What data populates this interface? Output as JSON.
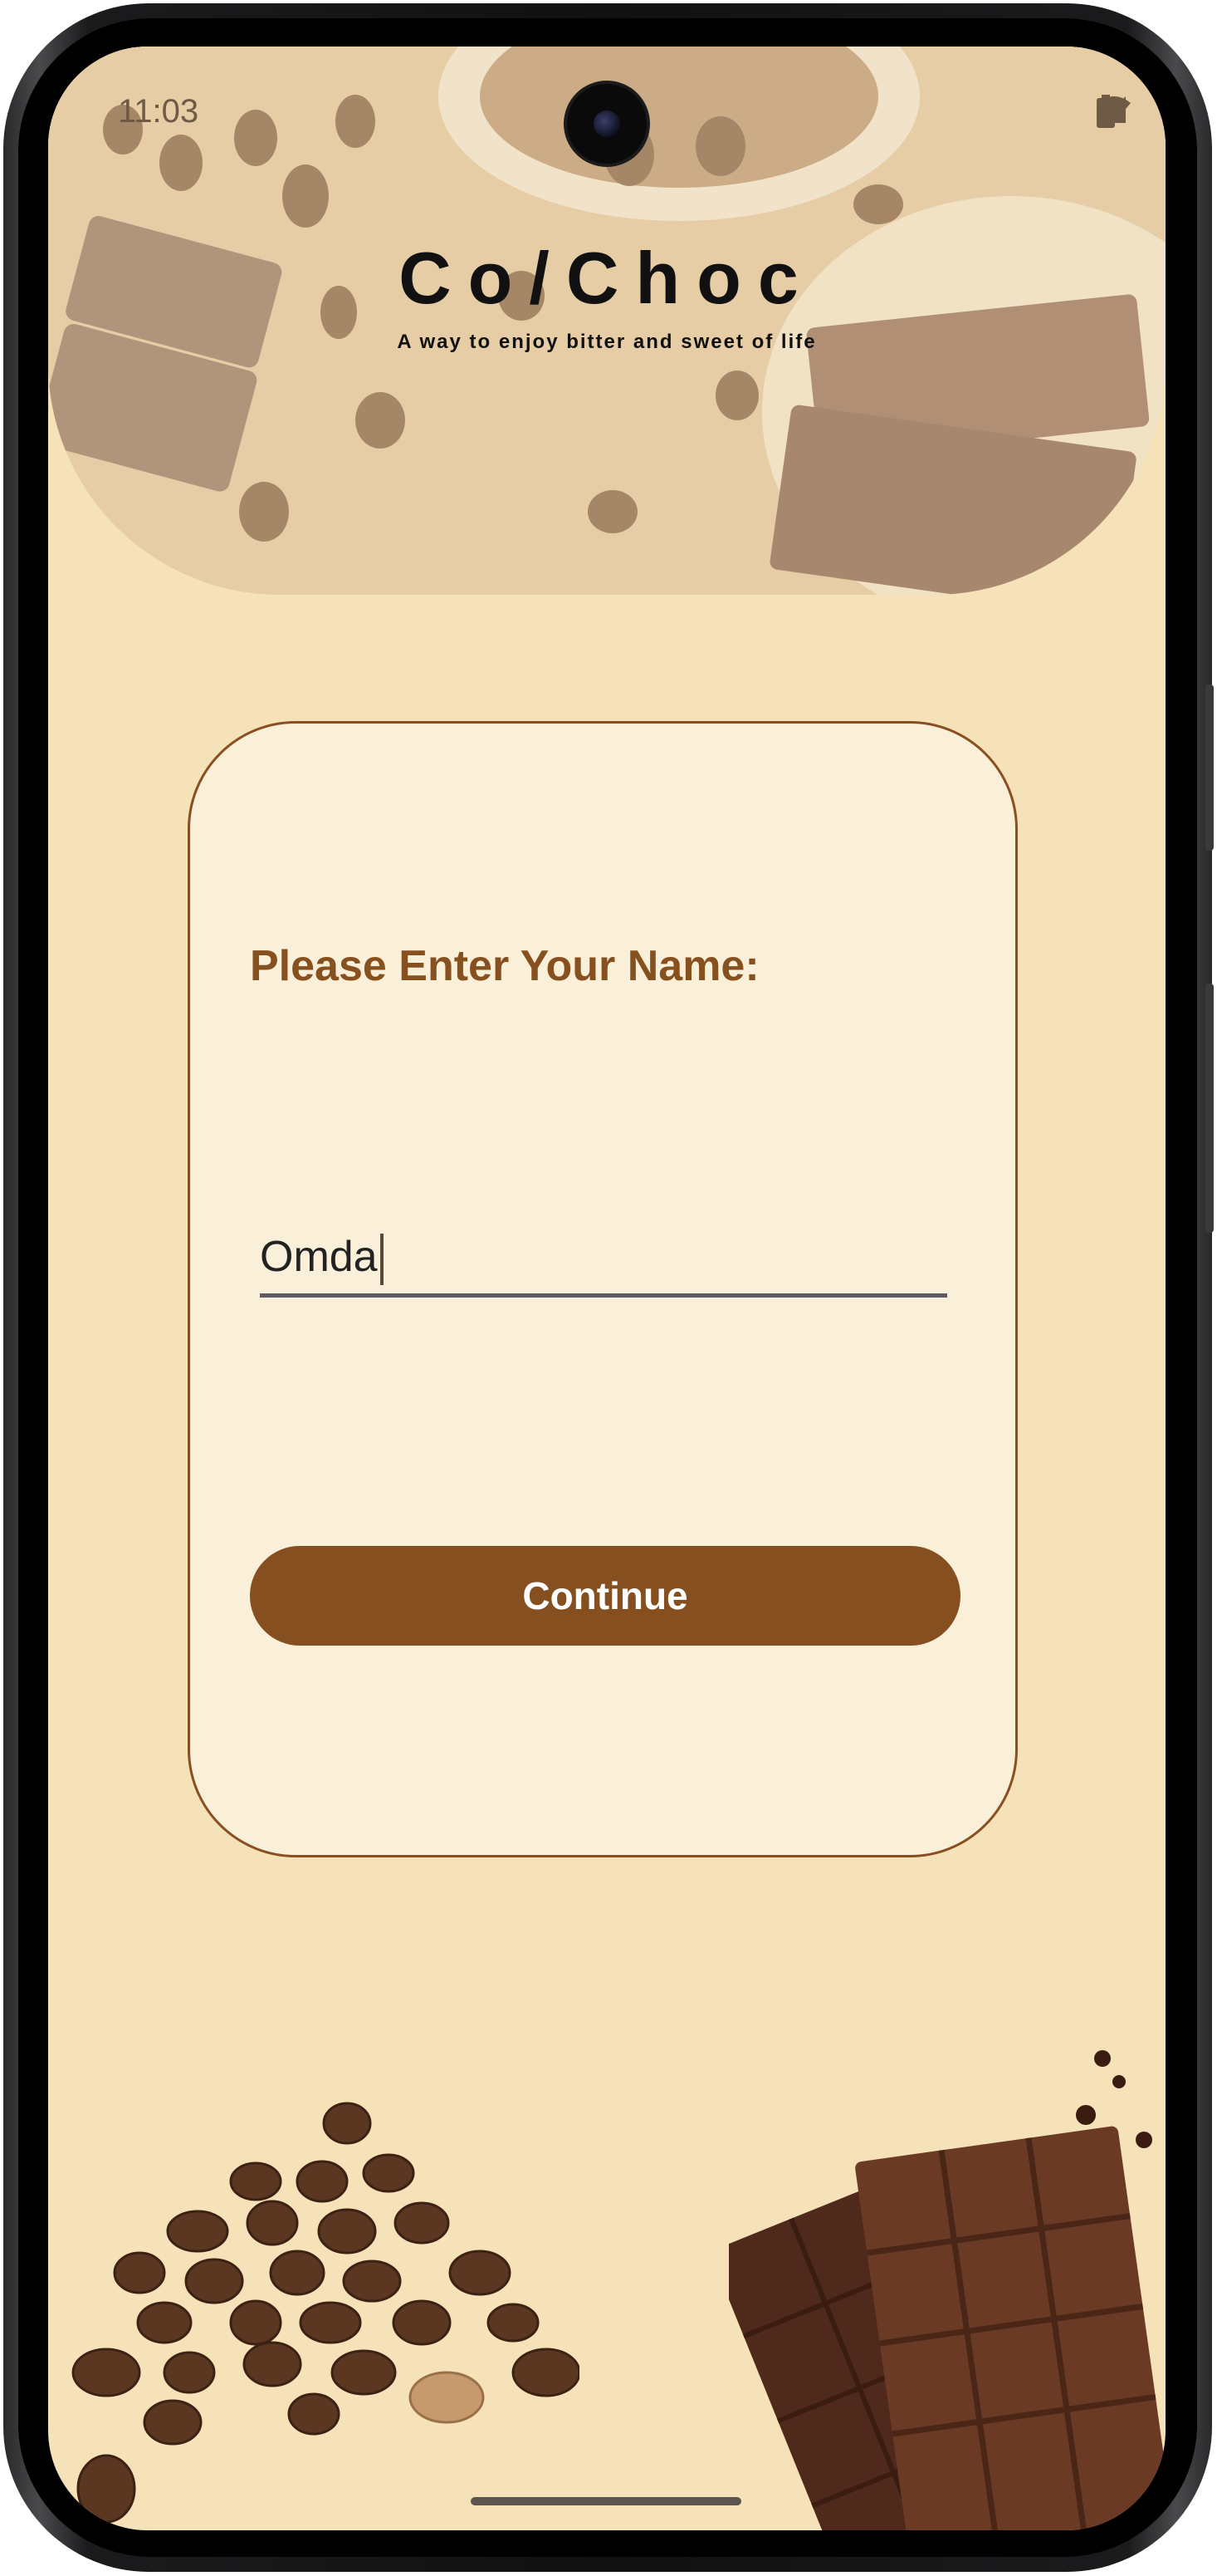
{
  "status_bar": {
    "time": "11:03"
  },
  "brand": {
    "title": "Co/Choc",
    "tagline": "A way to enjoy bitter and sweet of life"
  },
  "form": {
    "prompt": "Please Enter Your Name:",
    "name_value": "Omda",
    "continue_label": "Continue"
  },
  "icons": [
    "wifi-icon",
    "cellular-signal-icon",
    "battery-icon"
  ],
  "colors": {
    "background": "#f6e2b8",
    "card": "#faefd8",
    "accent": "#854f20"
  }
}
